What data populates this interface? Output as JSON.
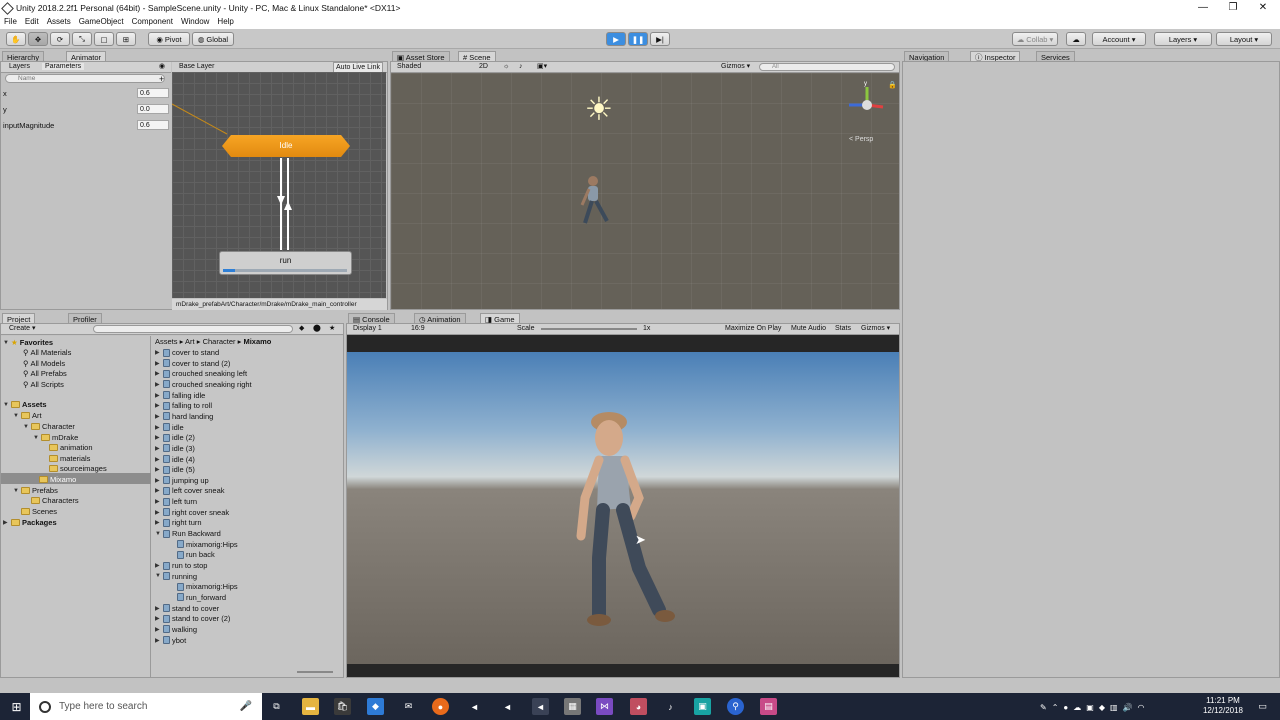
{
  "window": {
    "title": "Unity 2018.2.2f1 Personal (64bit) - SampleScene.unity - Unity - PC, Mac & Linux Standalone* <DX11>"
  },
  "menu": [
    "File",
    "Edit",
    "Assets",
    "GameObject",
    "Component",
    "Window",
    "Help"
  ],
  "toolbar": {
    "pivot": "Pivot",
    "global": "Global",
    "collab": "Collab ▾",
    "account": "Account ▾",
    "layers": "Layers ▾",
    "layout": "Layout ▾"
  },
  "tabs": {
    "hierarchy": "Hierarchy",
    "animator": "Animator",
    "asset_store": "Asset Store",
    "scene": "Scene",
    "navigation": "Navigation",
    "inspector": "Inspector",
    "services": "Services",
    "project": "Project",
    "profiler": "Profiler",
    "console": "Console",
    "animation": "Animation",
    "game": "Game"
  },
  "animator": {
    "layers_tab": "Layers",
    "parameters_tab": "Parameters",
    "search_placeholder": "Name",
    "base_layer": "Base Layer",
    "auto_live_link": "Auto Live Link",
    "params": [
      {
        "name": "x",
        "value": "0.6"
      },
      {
        "name": "y",
        "value": "0.0"
      },
      {
        "name": "inputMagnitude",
        "value": "0.6"
      }
    ],
    "states": {
      "idle": "Idle",
      "run": "run"
    },
    "footer_path": "mDrake_prefabArt/Character/mDrake/mDrake_main_controller"
  },
  "scene": {
    "shading": "Shaded",
    "mode2d": "2D",
    "gizmos": "Gizmos ▾",
    "search_placeholder": "All",
    "persp": "< Persp"
  },
  "game": {
    "display": "Display 1",
    "aspect": "16:9",
    "scale_label": "Scale",
    "scale_value": "1x",
    "maximize": "Maximize On Play",
    "mute": "Mute Audio",
    "stats": "Stats",
    "gizmos": "Gizmos ▾"
  },
  "project": {
    "create": "Create ▾",
    "breadcrumb": [
      "Assets",
      "Art",
      "Character",
      "Mixamo"
    ],
    "favorites_label": "Favorites",
    "favorites": [
      "All Materials",
      "All Models",
      "All Prefabs",
      "All Scripts"
    ],
    "assets_label": "Assets",
    "art": "Art",
    "character": "Character",
    "mdrake": "mDrake",
    "mdrake_children": [
      "animation",
      "materials",
      "sourceimages"
    ],
    "mixamo": "Mixamo",
    "prefabs": "Prefabs",
    "characters": "Characters",
    "scenes": "Scenes",
    "packages": "Packages",
    "files": [
      "cover to stand",
      "cover to stand (2)",
      "crouched sneaking left",
      "crouched sneaking right",
      "falling idle",
      "falling to roll",
      "hard landing",
      "idle",
      "idle (2)",
      "idle (3)",
      "idle (4)",
      "idle (5)",
      "jumping up",
      "left cover sneak",
      "left turn",
      "right cover sneak",
      "right turn",
      "Run Backward",
      "mixamorig:Hips",
      "run back",
      "run to stop",
      "running",
      "mixamorig:Hips",
      "run_forward",
      "stand to cover",
      "stand to cover (2)",
      "walking",
      "ybot"
    ]
  },
  "taskbar": {
    "search_placeholder": "Type here to search",
    "time": "11:21 PM",
    "date": "12/12/2018"
  }
}
